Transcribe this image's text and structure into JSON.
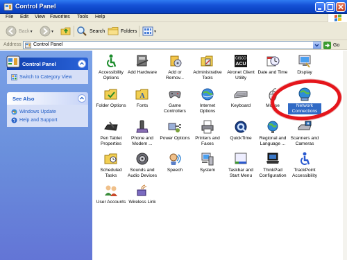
{
  "window": {
    "title": "Control Panel"
  },
  "menu": [
    "File",
    "Edit",
    "View",
    "Favorites",
    "Tools",
    "Help"
  ],
  "toolbar": {
    "back_label": "Back",
    "search_label": "Search",
    "folders_label": "Folders"
  },
  "address": {
    "label": "Address",
    "value": "Control Panel",
    "go_label": "Go"
  },
  "sidebar": {
    "control_panel": {
      "title": "Control Panel",
      "link": "Switch to Category View"
    },
    "see_also": {
      "title": "See Also",
      "links": [
        "Windows Update",
        "Help and Support"
      ]
    }
  },
  "items": [
    {
      "name": "Accessibility Options",
      "line1": "Accessibility",
      "line2": "Options",
      "icon": "accessibility-icon"
    },
    {
      "name": "Add Hardware",
      "line1": "Add Hardware",
      "line2": "",
      "icon": "add-hardware-icon"
    },
    {
      "name": "Add or Remove Programs",
      "line1": "Add or",
      "line2": "Remov...",
      "icon": "add-remove-programs-icon"
    },
    {
      "name": "Administrative Tools",
      "line1": "Administrative",
      "line2": "Tools",
      "icon": "administrative-tools-icon"
    },
    {
      "name": "Aironet Client Utility",
      "line1": "Aironet Client",
      "line2": "Utility",
      "icon": "aironet-icon",
      "badge": "CISCO ACU"
    },
    {
      "name": "Date and Time",
      "line1": "Date and Time",
      "line2": "",
      "icon": "clock-icon"
    },
    {
      "name": "Display",
      "line1": "Display",
      "line2": "",
      "icon": "display-icon"
    },
    {
      "name": "Folder Options",
      "line1": "Folder Options",
      "line2": "",
      "icon": "folder-options-icon"
    },
    {
      "name": "Fonts",
      "line1": "Fonts",
      "line2": "",
      "icon": "fonts-icon"
    },
    {
      "name": "Game Controllers",
      "line1": "Game",
      "line2": "Controllers",
      "icon": "game-controller-icon"
    },
    {
      "name": "Internet Options",
      "line1": "Internet",
      "line2": "Options",
      "icon": "internet-options-icon"
    },
    {
      "name": "Keyboard",
      "line1": "Keyboard",
      "line2": "",
      "icon": "keyboard-icon"
    },
    {
      "name": "Mouse",
      "line1": "Mouse",
      "line2": "",
      "icon": "mouse-icon"
    },
    {
      "name": "Network Connections",
      "line1": "Network",
      "line2": "Connections",
      "icon": "network-connections-icon",
      "selected": true
    },
    {
      "name": "Pen Tablet Properties",
      "line1": "Pen Tablet",
      "line2": "Properties",
      "icon": "pen-tablet-icon"
    },
    {
      "name": "Phone and Modem",
      "line1": "Phone and",
      "line2": "Modem ...",
      "icon": "phone-icon"
    },
    {
      "name": "Power Options",
      "line1": "Power Options",
      "line2": "",
      "icon": "power-options-icon"
    },
    {
      "name": "Printers and Faxes",
      "line1": "Printers and",
      "line2": "Faxes",
      "icon": "printer-icon"
    },
    {
      "name": "QuickTime",
      "line1": "QuickTime",
      "line2": "",
      "icon": "quicktime-icon"
    },
    {
      "name": "Regional and Language Options",
      "line1": "Regional and",
      "line2": "Language ...",
      "icon": "globe-icon"
    },
    {
      "name": "Scanners and Cameras",
      "line1": "Scanners and",
      "line2": "Cameras",
      "icon": "scanner-icon"
    },
    {
      "name": "Scheduled Tasks",
      "line1": "Scheduled",
      "line2": "Tasks",
      "icon": "scheduled-tasks-icon"
    },
    {
      "name": "Sounds and Audio Devices",
      "line1": "Sounds and",
      "line2": "Audio Devices",
      "icon": "speaker-icon"
    },
    {
      "name": "Speech",
      "line1": "Speech",
      "line2": "",
      "icon": "speech-icon"
    },
    {
      "name": "System",
      "line1": "System",
      "line2": "",
      "icon": "system-icon"
    },
    {
      "name": "Taskbar and Start Menu",
      "line1": "Taskbar and",
      "line2": "Start Menu",
      "icon": "taskbar-icon"
    },
    {
      "name": "ThinkPad Configuration",
      "line1": "ThinkPad",
      "line2": "Configuration",
      "icon": "thinkpad-icon"
    },
    {
      "name": "TrackPoint Accessibility",
      "line1": "TrackPoint",
      "line2": "Accessibility",
      "icon": "trackpoint-icon"
    },
    {
      "name": "User Accounts",
      "line1": "User Accounts",
      "line2": "",
      "icon": "users-icon"
    },
    {
      "name": "Wireless Link",
      "line1": "Wireless Link",
      "line2": "",
      "icon": "wireless-link-icon"
    }
  ],
  "colors": {
    "title_bar": "#0b43c4",
    "sidebar": "#6a8fdc",
    "selection": "#316ac5",
    "highlight_oval": "#e5151b"
  }
}
